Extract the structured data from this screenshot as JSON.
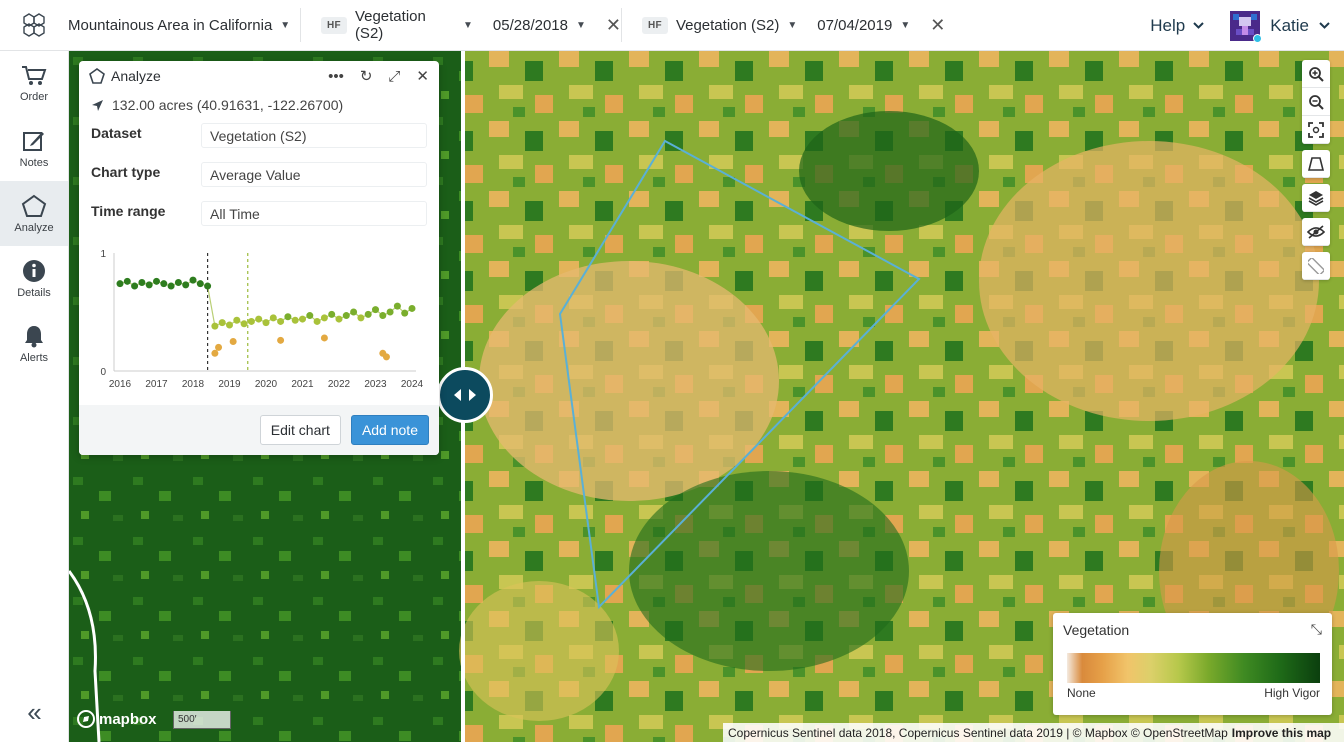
{
  "header": {
    "project_title": "Mountainous Area in California",
    "layer_left": {
      "badge": "HF",
      "name": "Vegetation (S2)",
      "date": "05/28/2018"
    },
    "layer_right": {
      "badge": "HF",
      "name": "Vegetation (S2)",
      "date": "07/04/2019"
    },
    "help_label": "Help",
    "user_name": "Katie"
  },
  "sidebar": {
    "items": [
      {
        "label": "Order",
        "icon": "cart-icon"
      },
      {
        "label": "Notes",
        "icon": "edit-note-icon"
      },
      {
        "label": "Analyze",
        "icon": "pentagon-icon",
        "active": true
      },
      {
        "label": "Details",
        "icon": "info-icon"
      },
      {
        "label": "Alerts",
        "icon": "bell-icon"
      }
    ],
    "collapse_icon": "double-chevron-left-icon"
  },
  "analyze_panel": {
    "title": "Analyze",
    "coords": "132.00 acres (40.91631, -122.26700)",
    "fields": [
      {
        "label": "Dataset",
        "value": "Vegetation (S2)"
      },
      {
        "label": "Chart type",
        "value": "Average Value"
      },
      {
        "label": "Time range",
        "value": "All Time"
      }
    ],
    "edit_button": "Edit chart",
    "add_button": "Add note"
  },
  "chart_data": {
    "type": "scatter",
    "x_ticks": [
      "2016",
      "2017",
      "2018",
      "2019",
      "2020",
      "2021",
      "2022",
      "2023",
      "2024"
    ],
    "y_ticks": [
      "0",
      "1"
    ],
    "ylim": [
      0,
      1
    ],
    "xlim": [
      2016,
      2024
    ],
    "markers": [
      {
        "x": 2018.4,
        "style": "dashed",
        "color": "#333333"
      },
      {
        "x": 2019.5,
        "style": "dashed",
        "color": "#9bbb3a"
      }
    ],
    "series": [
      {
        "x": [
          2016.0,
          2016.2,
          2016.4,
          2016.6,
          2016.8,
          2017.0,
          2017.2,
          2017.4,
          2017.6,
          2017.8,
          2018.0,
          2018.2,
          2018.4,
          2018.6,
          2018.8,
          2019.0,
          2019.2,
          2019.4,
          2019.6,
          2019.8,
          2020.0,
          2020.2,
          2020.4,
          2020.6,
          2020.8,
          2021.0,
          2021.2,
          2021.4,
          2021.6,
          2021.8,
          2022.0,
          2022.2,
          2022.4,
          2022.6,
          2022.8,
          2023.0,
          2023.2,
          2023.4,
          2023.6,
          2023.8,
          2024.0
        ],
        "y": [
          0.74,
          0.76,
          0.72,
          0.75,
          0.73,
          0.76,
          0.74,
          0.72,
          0.75,
          0.73,
          0.77,
          0.74,
          0.72,
          0.38,
          0.41,
          0.39,
          0.43,
          0.4,
          0.42,
          0.44,
          0.41,
          0.45,
          0.42,
          0.46,
          0.43,
          0.44,
          0.47,
          0.42,
          0.45,
          0.48,
          0.44,
          0.47,
          0.5,
          0.45,
          0.48,
          0.52,
          0.47,
          0.5,
          0.55,
          0.49,
          0.53
        ]
      },
      {
        "x": [
          2018.6,
          2018.7,
          2019.1,
          2020.4,
          2021.6,
          2023.2,
          2023.3
        ],
        "y": [
          0.15,
          0.2,
          0.25,
          0.26,
          0.28,
          0.15,
          0.12
        ]
      }
    ]
  },
  "map_tools": [
    {
      "icon": "zoom-in-icon"
    },
    {
      "icon": "zoom-out-icon"
    },
    {
      "icon": "fit-bounds-icon"
    },
    {
      "icon": "draw-polygon-icon"
    },
    {
      "icon": "layers-icon"
    },
    {
      "icon": "hide-eye-icon"
    },
    {
      "icon": "ruler-icon"
    }
  ],
  "legend": {
    "title": "Vegetation",
    "min_label": "None",
    "max_label": "High Vigor"
  },
  "attribution": {
    "text": "Copernicus Sentinel data 2018, Copernicus Sentinel data 2019 | © Mapbox © OpenStreetMap",
    "link": "Improve this map"
  },
  "mapbox_label": "mapbox",
  "scale_label": "500′"
}
